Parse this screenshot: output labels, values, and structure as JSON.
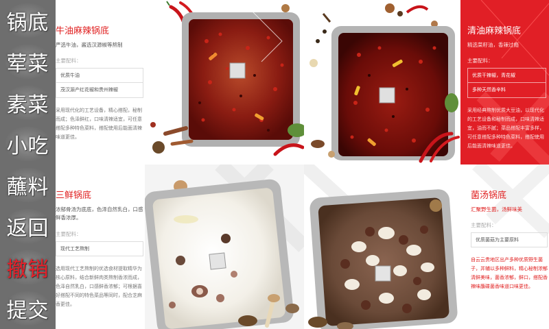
{
  "sidebar": {
    "items": [
      {
        "label": "锅底",
        "active": false
      },
      {
        "label": "荤菜",
        "active": false
      },
      {
        "label": "素菜",
        "active": false
      },
      {
        "label": "小吃",
        "active": false
      },
      {
        "label": "蘸料",
        "active": false
      },
      {
        "label": "返回",
        "active": false
      },
      {
        "label": "撤销",
        "active": true
      },
      {
        "label": "提交",
        "active": false
      }
    ]
  },
  "cards": [
    {
      "title": "牛油麻辣锅底",
      "tagline": "严选牛油，酱选汉源椒等熬制",
      "ingredients_label": "主要配料：",
      "ingredients": [
        "优质牛油",
        "茂汉源产红花椒和贵州辣椒"
      ],
      "description": "采用现代化的工艺设备，精心搭配，秘制而成；色泽鲜红，口味清辣适宜，可任意搭配多种特色菜料，搭配使用后能面清辣味道更佳。"
    },
    {
      "title": "清油麻辣锅底",
      "tagline": "精选菜籽油，香辣过瘾",
      "ingredients_label": "主要配料：",
      "ingredients": [
        "优质干辣椒，青花椒",
        "多种天然香辛料"
      ],
      "description": "采用经典熬制优质大豆油，以现代化的工艺设备和秘制而成，口味清辣适宜，油而不腻；菜品搭配丰富多样，可任意搭配多种特色菜料，搭配使用后能面清辣味道更佳。"
    },
    {
      "title": "三鲜锅底",
      "tagline": "浓郁骨汤为底底，色泽自然乳白，口感鲜香浓厚。",
      "ingredients_label": "主要配料：",
      "ingredients": [
        "现代工艺熬制"
      ],
      "description": "选用现代工艺熬制的优选食材提取精华为核心原料，结合新鲜肉类熬制香浓而成，色泽自然乳白，口感鲜香浓郁；可根据喜好搭配不同的特色菜品等同时，配合芝麻香更佳。"
    },
    {
      "title": "菌汤锅底",
      "tagline": "汇聚野生菌，汤鲜味美",
      "ingredients_label": "主要配料：",
      "ingredients": [
        "优质菌菇为主要原料"
      ],
      "description": "自云云贵地区出产多种优质野生菌子，并辅以多种鲜料，精心秘制浓郁清鲜美味，菌香浓郁，鲜口，搭配香辣味蘸碟菌香味道口味更佳。"
    }
  ]
}
